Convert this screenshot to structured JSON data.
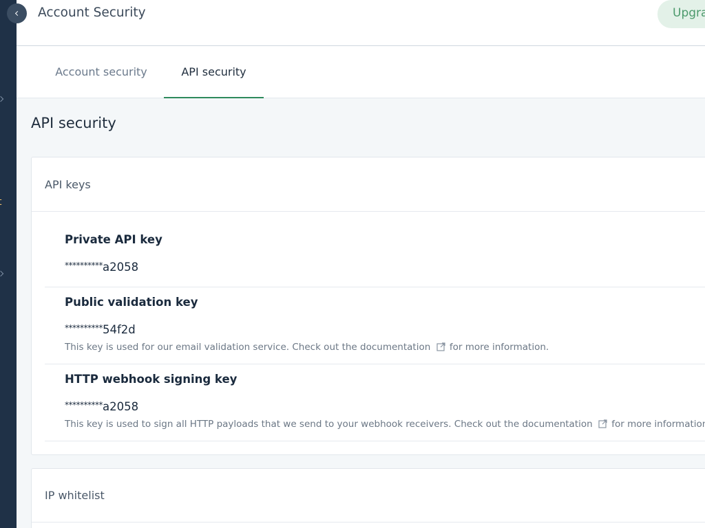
{
  "header": {
    "title": "Account Security",
    "upgrade_label": "Upgrade"
  },
  "sidebar": {
    "cutoff_text": "t"
  },
  "tabs": [
    {
      "label": "Account security",
      "active": false
    },
    {
      "label": "API security",
      "active": true
    }
  ],
  "section_title": "API security",
  "api_keys_card": {
    "title": "API keys",
    "keys": [
      {
        "name": "Private API key",
        "mask": "**********",
        "suffix": "a2058"
      },
      {
        "name": "Public validation key",
        "mask": "**********",
        "suffix": "54f2d",
        "desc_pre": "This key is used for our email validation service. Check out the documentation",
        "desc_post": "for more information."
      },
      {
        "name": "HTTP webhook signing key",
        "mask": "**********",
        "suffix": "a2058",
        "desc_pre": "This key is used to sign all HTTP payloads that we send to your webhook receivers. Check out the documentation",
        "desc_post": "for more information."
      }
    ]
  },
  "ip_card": {
    "title": "IP whitelist"
  },
  "colors": {
    "sidebar_bg": "#1f3147",
    "accent_green": "#2e8a5c",
    "upgrade_bg": "#e3f1e8"
  },
  "icons": [
    "chevron-left-icon",
    "external-link-icon"
  ]
}
